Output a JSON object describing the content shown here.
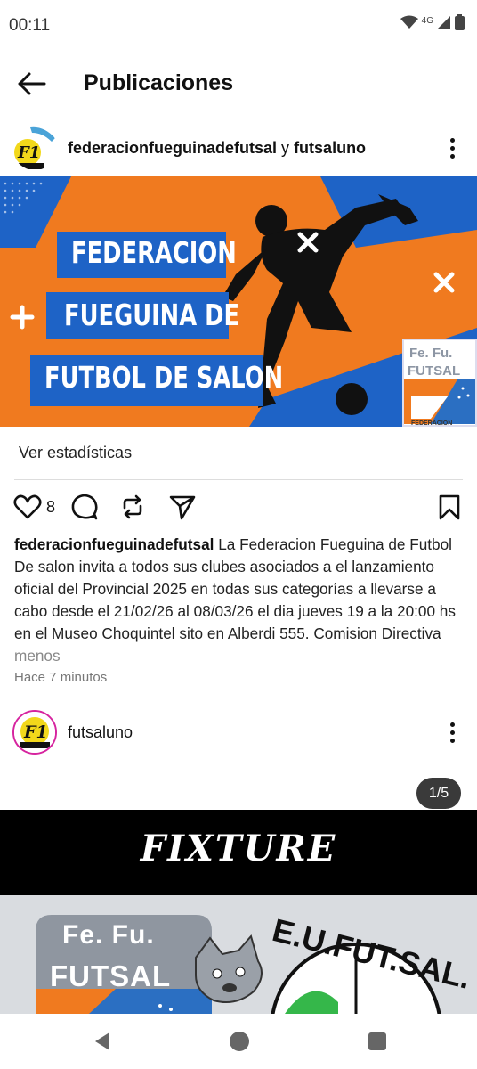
{
  "status_bar": {
    "time": "00:11",
    "network": "4G"
  },
  "header": {
    "title": "Publicaciones"
  },
  "post1": {
    "author_user1": "federacionfueguinadefutsal",
    "author_joiner": " y ",
    "author_user2": "futsaluno",
    "banner_line1": "FEDERACION",
    "banner_line2": "FUEGUINA DE",
    "banner_line3": "FUTBOL DE SALON",
    "badge_line1": "Fe. Fu.",
    "badge_line2": "FUTSAL",
    "badge_footer": "FEDERACION",
    "stats_link": "Ver estadísticas",
    "like_count": "8",
    "caption_user": "federacionfueguinadefutsal",
    "caption_text": " La Federacion Fueguina de Futbol De salon invita a todos sus clubes asociados a el lanzamiento oficial del Provincial 2025 en todas sus categorías a llevarse a cabo desde el 21/02/26 al 08/03/26 el dia jueves 19 a la 20:00 hs en el Museo Choquintel sito en Alberdi 555. Comision Directiva ",
    "caption_less": "menos",
    "timestamp": "Hace 7 minutos"
  },
  "post2": {
    "author": "futsaluno",
    "image_counter": "1/5",
    "fixture_title": "FIXTURE",
    "logo_line1": "Fe. Fu.",
    "logo_line2": "FUTSAL",
    "logo_arc": "E.U.FUT.SAL."
  },
  "colors": {
    "orange": "#f07a1f",
    "blue": "#1e63c6",
    "black": "#000000"
  },
  "icons": {
    "status": [
      "wifi-icon",
      "signal-icon",
      "battery-icon"
    ],
    "actions": [
      "heart-icon",
      "comment-icon",
      "repost-icon",
      "share-icon",
      "bookmark-icon"
    ],
    "nav": [
      "back-triangle-icon",
      "home-circle-icon",
      "recents-square-icon"
    ]
  }
}
